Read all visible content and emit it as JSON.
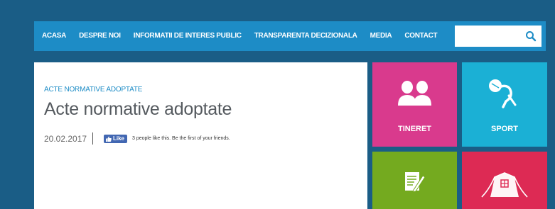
{
  "nav": {
    "items": [
      {
        "label": "ACASA"
      },
      {
        "label": "DESPRE NOI"
      },
      {
        "label": "INFORMATII DE INTERES PUBLIC"
      },
      {
        "label": "TRANSPARENTA DECIZIONALA"
      },
      {
        "label": "MEDIA"
      },
      {
        "label": "CONTACT"
      }
    ],
    "search": {
      "placeholder": "",
      "icon": "search-icon"
    }
  },
  "content": {
    "breadcrumb": "ACTE NORMATIVE ADOPTATE",
    "title": "Acte normative adoptate",
    "date": "20.02.2017",
    "like_label": "Like",
    "like_text": "3 people like this. Be the first of your friends."
  },
  "tiles": [
    {
      "label": "TINERET",
      "color": "#d93a8d",
      "icon": "people-icon"
    },
    {
      "label": "SPORT",
      "color": "#1bb0d5",
      "icon": "runner-icon"
    },
    {
      "label": "",
      "color": "#74aa1f",
      "icon": "document-icon"
    },
    {
      "label": "",
      "color": "#dd2a54",
      "icon": "tent-icon"
    }
  ],
  "colors": {
    "background": "#1a5d86",
    "navbar": "#1d8cc6",
    "accent": "#1d8cc6"
  }
}
